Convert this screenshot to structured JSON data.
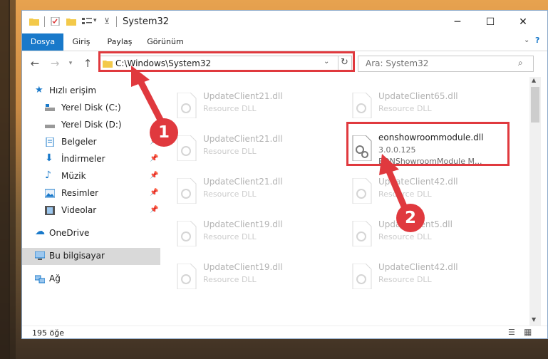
{
  "window": {
    "title": "System32"
  },
  "ribbon": {
    "tabs": [
      "Dosya",
      "Giriş",
      "Paylaş",
      "Görünüm"
    ]
  },
  "address": {
    "path": "C:\\Windows\\System32"
  },
  "search": {
    "placeholder": "Ara: System32"
  },
  "sidebar": {
    "items": [
      {
        "label": "Hızlı erişim",
        "icon": "star-icon"
      },
      {
        "label": "Yerel Disk (C:)",
        "icon": "drive-icon"
      },
      {
        "label": "Yerel Disk (D:)",
        "icon": "drive-icon"
      },
      {
        "label": "Belgeler",
        "icon": "document-icon"
      },
      {
        "label": "İndirmeler",
        "icon": "download-icon"
      },
      {
        "label": "Müzik",
        "icon": "music-icon"
      },
      {
        "label": "Resimler",
        "icon": "picture-icon"
      },
      {
        "label": "Videolar",
        "icon": "video-icon"
      },
      {
        "label": "OneDrive",
        "icon": "cloud-icon"
      },
      {
        "label": "Bu bilgisayar",
        "icon": "computer-icon"
      },
      {
        "label": "Ağ",
        "icon": "network-icon"
      }
    ]
  },
  "files": [
    {
      "name": "UpdateClient21.dll",
      "desc": "Resource DLL"
    },
    {
      "name": "UpdateClient65.dll",
      "desc": "Resource DLL"
    },
    {
      "name": "UpdateClient21.dll",
      "desc": "Resource DLL"
    },
    {
      "name": "eonshowroommodule.dll",
      "version": "3.0.0.125",
      "desc": "EONShowroomModule M..."
    },
    {
      "name": "UpdateClient21.dll",
      "desc": "Resource DLL"
    },
    {
      "name": "UpdateClient42.dll",
      "desc": "Resource DLL"
    },
    {
      "name": "UpdateClient19.dll",
      "desc": "Resource DLL"
    },
    {
      "name": "UpdateClient5.dll",
      "desc": "Resource DLL"
    },
    {
      "name": "UpdateClient19.dll",
      "desc": "Resource DLL"
    },
    {
      "name": "UpdateClient42.dll",
      "desc": "Resource DLL"
    }
  ],
  "status": {
    "count": "195 öğe"
  },
  "annotations": {
    "step1": "1",
    "step2": "2",
    "color": "#e0393e"
  }
}
